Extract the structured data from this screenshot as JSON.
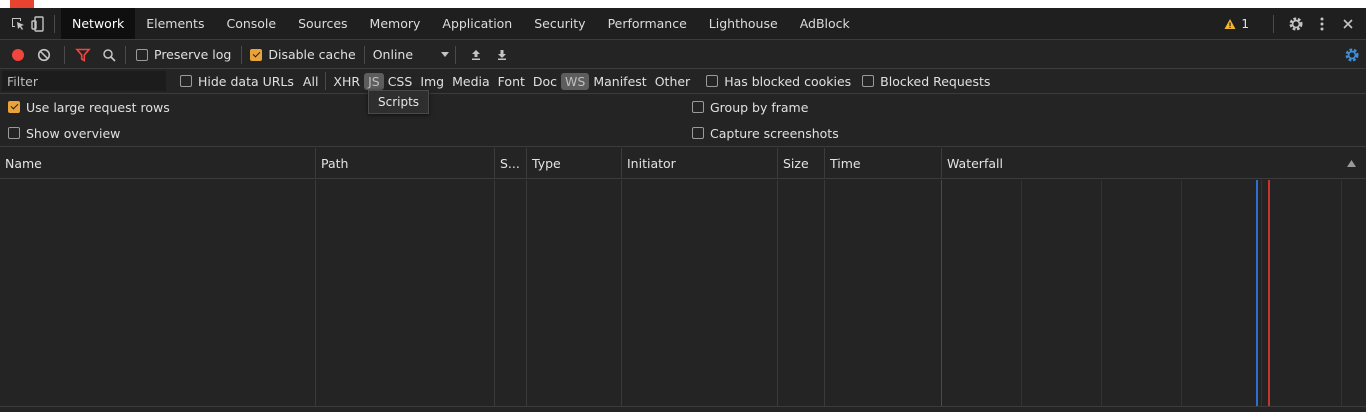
{
  "devtools": {
    "tabs": [
      {
        "label": "Network",
        "active": true
      },
      {
        "label": "Elements"
      },
      {
        "label": "Console"
      },
      {
        "label": "Sources"
      },
      {
        "label": "Memory"
      },
      {
        "label": "Application"
      },
      {
        "label": "Security"
      },
      {
        "label": "Performance"
      },
      {
        "label": "Lighthouse"
      },
      {
        "label": "AdBlock"
      }
    ],
    "warning_count": "1",
    "icons": {
      "inspect": "inspect-element-icon",
      "device": "device-toolbar-icon",
      "warning": "warning-icon",
      "settings": "gear-icon",
      "more": "kebab-menu-icon",
      "close": "close-icon"
    }
  },
  "toolbar": {
    "preserve_log": "Preserve log",
    "disable_cache": "Disable cache",
    "throttling": "Online",
    "icons": {
      "record": "record-icon",
      "clear": "clear-icon",
      "filter": "filter-icon",
      "search": "search-icon",
      "import": "import-har-icon",
      "export": "export-har-icon",
      "settings": "gear-icon"
    }
  },
  "filterbar": {
    "placeholder": "Filter",
    "hide_data_urls": "Hide data URLs",
    "types": [
      "All",
      "XHR",
      "JS",
      "CSS",
      "Img",
      "Media",
      "Font",
      "Doc",
      "WS",
      "Manifest",
      "Other"
    ],
    "highlighted": [
      "JS",
      "WS"
    ],
    "has_blocked_cookies": "Has blocked cookies",
    "blocked_requests": "Blocked Requests"
  },
  "settings": {
    "large_rows": "Use large request rows",
    "show_overview": "Show overview",
    "group_by_frame": "Group by frame",
    "capture_screenshots": "Capture screenshots"
  },
  "tooltip": "Scripts",
  "table": {
    "columns": [
      "Name",
      "Path",
      "S...",
      "Type",
      "Initiator",
      "Size",
      "Time",
      "Waterfall"
    ],
    "sort_icon": "sort-ascending-icon"
  },
  "colors": {
    "accent": "#e8a33b",
    "record": "#f2453d",
    "filter": "#f2453d",
    "settings_blue": "#3f8ed8",
    "dom_line": "#2f6fd0",
    "load_line": "#c5352f"
  }
}
